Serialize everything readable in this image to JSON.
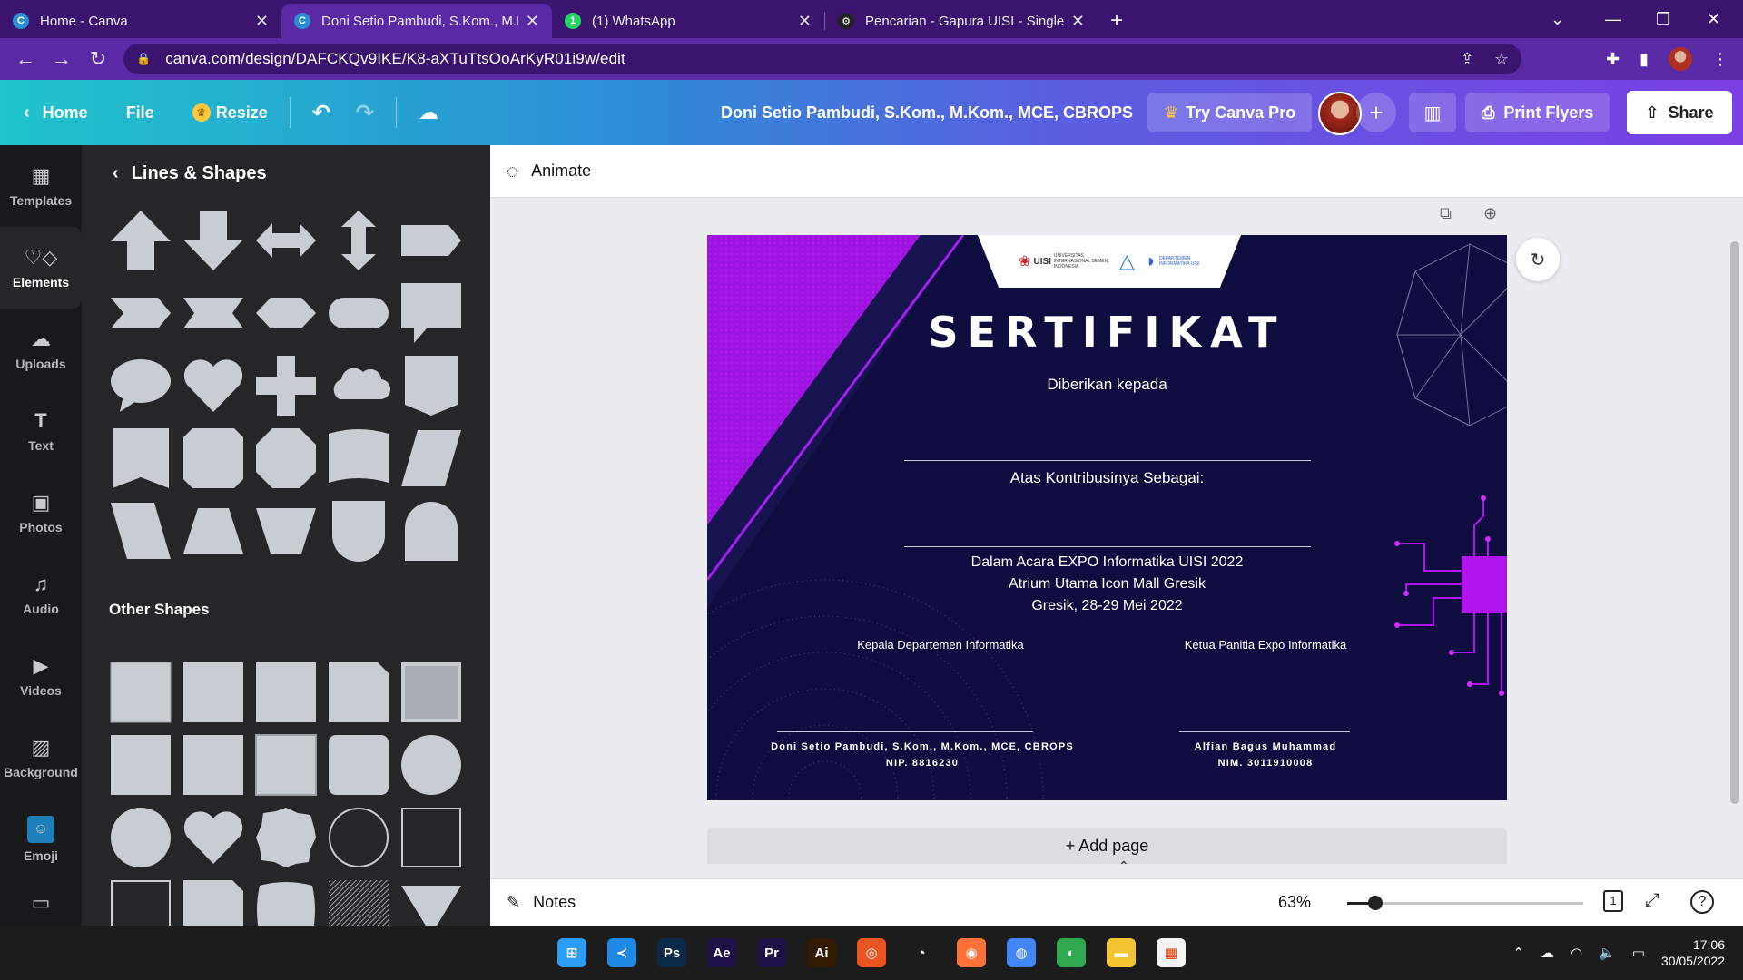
{
  "browser": {
    "tabs": [
      {
        "title": "Home - Canva",
        "icon": "canva-icon",
        "icon_color": "#2b8fd6",
        "active": false
      },
      {
        "title": "Doni Setio Pambudi, S.Kom., M.K",
        "icon": "canva-icon",
        "icon_color": "#2b8fd6",
        "active": true
      },
      {
        "title": "(1) WhatsApp",
        "icon": "whatsapp-icon",
        "icon_color": "#25d366",
        "active": false
      },
      {
        "title": "Pencarian - Gapura UISI - Single S",
        "icon": "gapura-icon",
        "icon_color": "#222222",
        "active": false
      }
    ],
    "url": "canva.com/design/DAFCKQv9IKE/K8-aXTuTtsOoArKyR01i9w/edit"
  },
  "header": {
    "home": "Home",
    "file": "File",
    "resize": "Resize",
    "doc_title": "Doni Setio Pambudi, S.Kom., M.Kom., MCE, CBROPS",
    "try_pro": "Try Canva Pro",
    "print": "Print Flyers",
    "share": "Share"
  },
  "rail": [
    {
      "label": "Templates",
      "icon": "templates-icon"
    },
    {
      "label": "Elements",
      "icon": "elements-icon",
      "active": true
    },
    {
      "label": "Uploads",
      "icon": "uploads-icon"
    },
    {
      "label": "Text",
      "icon": "text-icon"
    },
    {
      "label": "Photos",
      "icon": "photos-icon"
    },
    {
      "label": "Audio",
      "icon": "audio-icon"
    },
    {
      "label": "Videos",
      "icon": "videos-icon"
    },
    {
      "label": "Background",
      "icon": "background-icon"
    },
    {
      "label": "Emoji",
      "icon": "emoji-icon"
    }
  ],
  "panel": {
    "title": "Lines & Shapes",
    "other_title": "Other Shapes"
  },
  "editor": {
    "animate": "Animate",
    "add_page": "+ Add page",
    "notes": "Notes",
    "zoom": "63%",
    "zoom_level": 0.12
  },
  "certificate": {
    "title": "SERTIFIKAT",
    "given_to": "Diberikan kepada",
    "for_contribution": "Atas Kontribusinya Sebagai:",
    "event_line1": "Dalam Acara EXPO Informatika UISI 2022",
    "event_line2": "Atrium Utama Icon Mall Gresik",
    "event_line3": "Gresik, 28-29 Mei 2022",
    "sig1_role": "Kepala Departemen Informatika",
    "sig1_name": "Doni Setio Pambudi, S.Kom., M.Kom., MCE, CBROPS",
    "sig1_id": "NIP. 8816230",
    "sig2_role": "Ketua Panitia Expo Informatika",
    "sig2_name": "Alfian Bagus Muhammad",
    "sig2_id": "NIM. 3011910008",
    "logo1": "UISI",
    "logo1_sub": "UNIVERSITAS INTERNASIONAL SEMEN INDONESIA",
    "logo3_sub": "DEPARTEMEN INFORMATIKA UISI"
  },
  "taskbar": {
    "time": "17:06",
    "date": "30/05/2022",
    "apps": [
      {
        "name": "windows-start-icon",
        "label": "",
        "color": "#2a9df4"
      },
      {
        "name": "vscode-icon",
        "label": "",
        "color": "#1e88e5"
      },
      {
        "name": "photoshop-icon",
        "label": "Ps",
        "color": "#0b2a4a"
      },
      {
        "name": "after-effects-icon",
        "label": "Ae",
        "color": "#1d1148"
      },
      {
        "name": "premiere-icon",
        "label": "Pr",
        "color": "#1d1148"
      },
      {
        "name": "illustrator-icon",
        "label": "Ai",
        "color": "#331b00"
      },
      {
        "name": "ubuntu-icon",
        "label": "",
        "color": "#e95420"
      },
      {
        "name": "blender-icon",
        "label": "",
        "color": "#1c1c1c"
      },
      {
        "name": "firefox-icon",
        "label": "",
        "color": "#ff7139"
      },
      {
        "name": "chrome-icon",
        "label": "",
        "color": "#4285f4"
      },
      {
        "name": "edge-icon",
        "label": "",
        "color": "#2fa84f"
      },
      {
        "name": "file-explorer-icon",
        "label": "",
        "color": "#f4c430"
      },
      {
        "name": "ms-store-icon",
        "label": "",
        "color": "#f3f3f3"
      }
    ]
  }
}
